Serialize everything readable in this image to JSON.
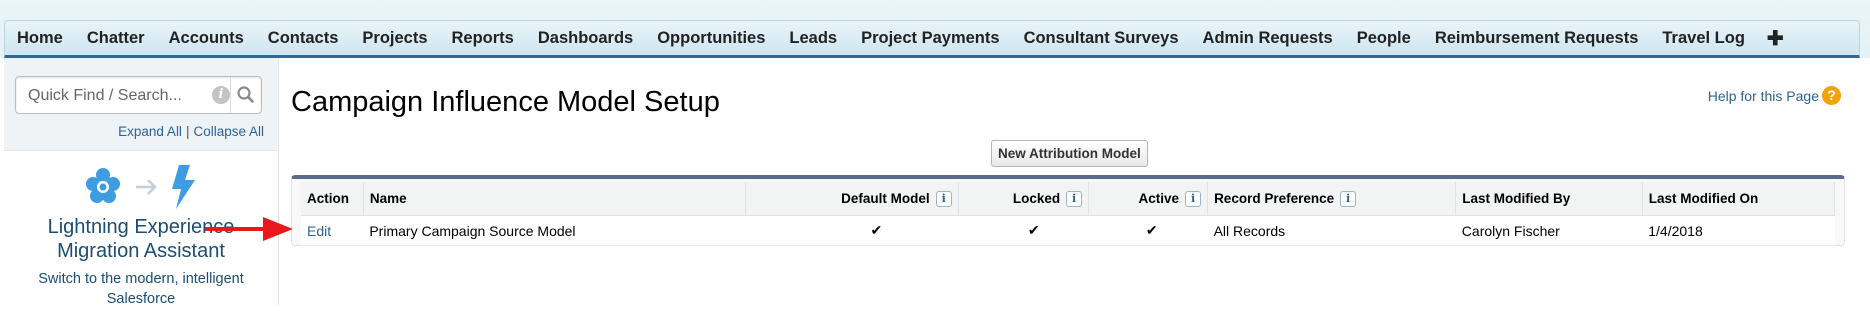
{
  "tabs": [
    "Home",
    "Chatter",
    "Accounts",
    "Contacts",
    "Projects",
    "Reports",
    "Dashboards",
    "Opportunities",
    "Leads",
    "Project Payments",
    "Consultant Surveys",
    "Admin Requests",
    "People",
    "Reimbursement Requests",
    "Travel Log",
    "✚"
  ],
  "sidebar": {
    "search_placeholder": "Quick Find / Search...",
    "expand_all": "Expand All",
    "separator": "|",
    "collapse_all": "Collapse All",
    "lex_title_line1": "Lightning Experience",
    "lex_title_line2": "Migration Assistant",
    "lex_desc_line1": "Switch to the modern, intelligent",
    "lex_desc_line2": "Salesforce"
  },
  "main": {
    "title": "Campaign Influence Model Setup",
    "help_label": "Help for this Page",
    "help_icon": "?",
    "new_button": "New Attribution Model"
  },
  "table": {
    "headers": {
      "action": "Action",
      "name": "Name",
      "default": "Default Model",
      "locked": "Locked",
      "active": "Active",
      "record_pref": "Record Preference",
      "modified_by": "Last Modified By",
      "modified_on": "Last Modified On"
    },
    "info_icon": "i",
    "rows": [
      {
        "action": "Edit",
        "name": "Primary Campaign Source Model",
        "default": "✔",
        "locked": "✔",
        "active": "✔",
        "record_pref": "All Records",
        "modified_by": "Carolyn Fischer",
        "modified_on": "1/4/2018"
      }
    ]
  },
  "colors": {
    "link": "#2a6496",
    "tab_underline": "#2f6a96",
    "arrow": "#e8191c",
    "help_icon": "#f0a30a",
    "lex_icon": "#3f9ce3"
  }
}
